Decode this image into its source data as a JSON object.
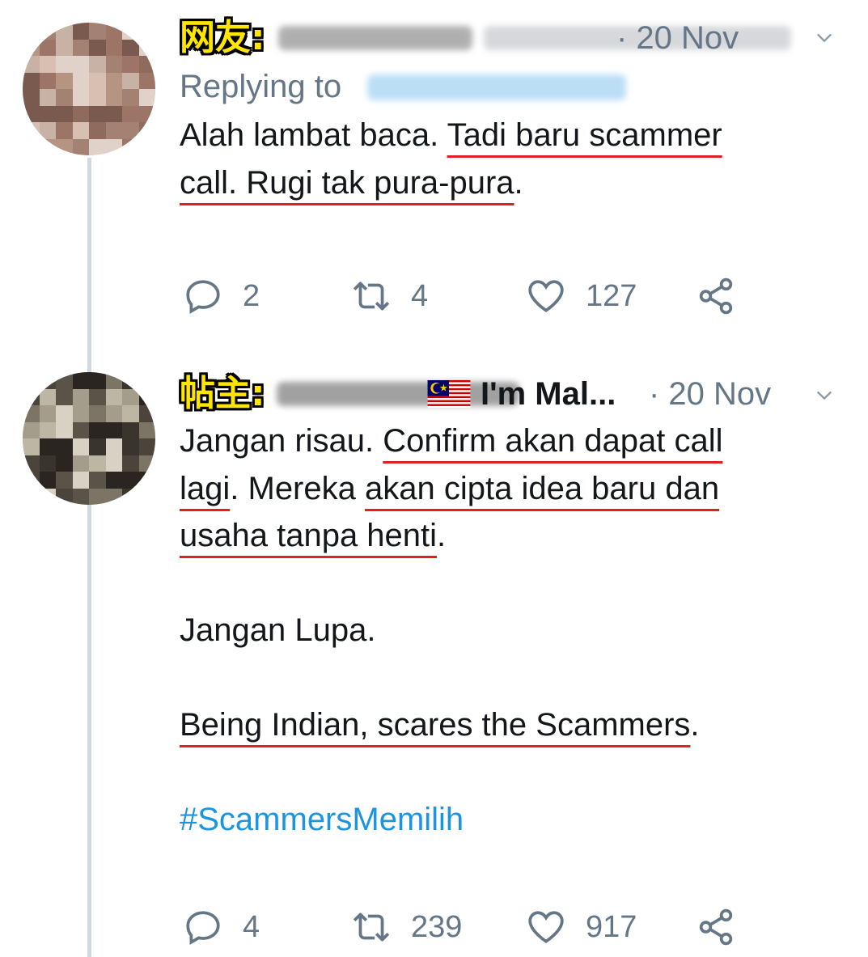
{
  "tweets": [
    {
      "tag": "网友:",
      "date": "· 20 Nov",
      "replying_prefix": "Replying to",
      "text_lines": {
        "p1": "Alah lambat baca. ",
        "u1": "Tadi baru scammer",
        "u2": "call. Rugi tak pura-pura",
        "p2": "."
      },
      "stats": {
        "replies": "2",
        "retweets": "4",
        "likes": "127"
      }
    },
    {
      "tag": "帖主:",
      "display_name": "I'm Mal...",
      "date": "· 20 Nov",
      "text": {
        "p1": "Jangan risau. ",
        "u1": "Confirm akan dapat call",
        "u2": "lagi",
        "p2": ". Mereka ",
        "u3": "akan cipta idea baru dan",
        "u4": "usaha tanpa henti",
        "p3": ".",
        "line2": "Jangan Lupa.",
        "u5": "Being Indian, scares the Scammers",
        "p4": ".",
        "hashtag": "#ScammersMemilih"
      },
      "stats": {
        "replies": "4",
        "retweets": "239",
        "likes": "917"
      }
    }
  ],
  "icons": {
    "reply": "reply-icon",
    "retweet": "retweet-icon",
    "like": "heart-icon",
    "share": "share-icon",
    "menu": "chevron-down-icon",
    "flag": "malaysia-flag-icon"
  },
  "colors": {
    "underline": "#e02121",
    "hashtag": "#1b95e0",
    "muted": "#657786",
    "tag": "#ffe600"
  }
}
